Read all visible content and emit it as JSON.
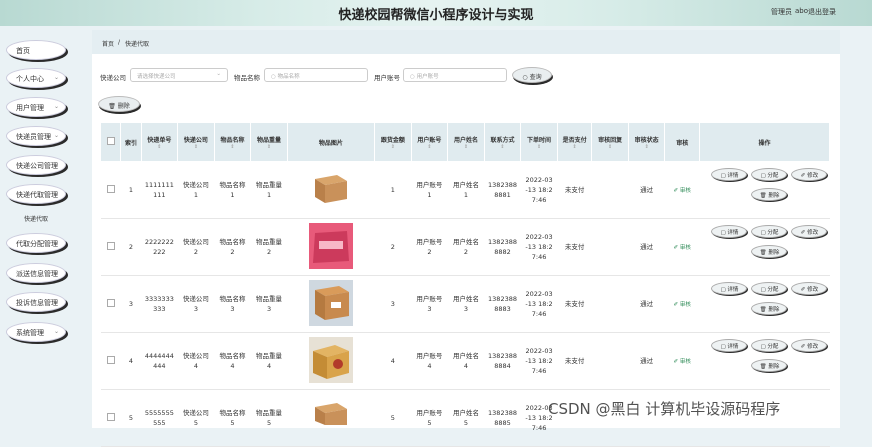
{
  "header": {
    "title": "快递校园帮微信小程序设计与实现",
    "admin_role": "管理员",
    "admin_name": "abo",
    "logout": "退出登录"
  },
  "sidebar": {
    "items": [
      {
        "label": "首页",
        "chev": ""
      },
      {
        "label": "个人中心",
        "chev": "⌄"
      },
      {
        "label": "用户管理",
        "chev": "⌄"
      },
      {
        "label": "快递员管理",
        "chev": "⌄"
      },
      {
        "label": "快递公司管理",
        "chev": "⌄"
      },
      {
        "label": "快递代取管理",
        "chev": "⌄"
      },
      {
        "label": "代取分配管理",
        "chev": "⌄"
      },
      {
        "label": "派送信息管理",
        "chev": "⌄"
      },
      {
        "label": "投诉信息管理",
        "chev": "⌄"
      },
      {
        "label": "系统管理",
        "chev": "⌄"
      }
    ],
    "sub": "快递代取"
  },
  "breadcrumb": {
    "home": "首页",
    "sep": "/",
    "current": "快递代取"
  },
  "filters": {
    "company_label": "快递公司",
    "company_ph": "请选择快递公司",
    "goods_label": "物品名称",
    "goods_ph": "物品名称",
    "user_label": "用户账号",
    "user_ph": "用户账号",
    "search": "查询"
  },
  "actions": {
    "delete": "删除"
  },
  "table": {
    "headers": {
      "index": "索引",
      "num": "快递单号",
      "company": "快递公司",
      "name": "物品名称",
      "weight": "物品重量",
      "image": "物品图片",
      "fee": "跟货金额",
      "account": "用户账号",
      "uname": "用户姓名",
      "contact": "联系方式",
      "time": "下单时间",
      "paid": "是否支付",
      "reply": "审核回复",
      "status": "审核状态",
      "audit": "审核",
      "ops": "操作"
    },
    "sort_arrows": "⇕",
    "rows": [
      {
        "index": "1",
        "num": "1111111\n111",
        "company": "快递公司\n1",
        "name": "物品名称\n1",
        "weight": "物品重量\n1",
        "fee": "1",
        "account": "用户账号\n1",
        "uname": "用户姓名\n1",
        "contact": "1382388\n8881",
        "time": "2022-03\n-13 18:2\n7:46",
        "paid": "未支付",
        "reply": "",
        "status": "通过",
        "audit": "✐ 审核"
      },
      {
        "index": "2",
        "num": "2222222\n222",
        "company": "快递公司\n2",
        "name": "物品名称\n2",
        "weight": "物品重量\n2",
        "fee": "2",
        "account": "用户账号\n2",
        "uname": "用户姓名\n2",
        "contact": "1382388\n8882",
        "time": "2022-03\n-13 18:2\n7:46",
        "paid": "未支付",
        "reply": "",
        "status": "通过",
        "audit": "✐ 审核"
      },
      {
        "index": "3",
        "num": "3333333\n333",
        "company": "快递公司\n3",
        "name": "物品名称\n3",
        "weight": "物品重量\n3",
        "fee": "3",
        "account": "用户账号\n3",
        "uname": "用户姓名\n3",
        "contact": "1382388\n8883",
        "time": "2022-03\n-13 18:2\n7:46",
        "paid": "未支付",
        "reply": "",
        "status": "通过",
        "audit": "✐ 审核"
      },
      {
        "index": "4",
        "num": "4444444\n444",
        "company": "快递公司\n4",
        "name": "物品名称\n4",
        "weight": "物品重量\n4",
        "fee": "4",
        "account": "用户账号\n4",
        "uname": "用户姓名\n4",
        "contact": "1382388\n8884",
        "time": "2022-03\n-13 18:2\n7:46",
        "paid": "未支付",
        "reply": "",
        "status": "通过",
        "audit": "✐ 审核"
      },
      {
        "index": "5",
        "num": "5555555\n555",
        "company": "快递公司\n5",
        "name": "物品名称\n5",
        "weight": "物品重量\n5",
        "fee": "5",
        "account": "用户账号\n5",
        "uname": "用户姓名\n5",
        "contact": "1382388\n8885",
        "time": "2022-03\n-13 18:2\n7:46",
        "paid": "",
        "reply": "",
        "status": "",
        "audit": ""
      }
    ],
    "op_labels": {
      "detail": "详情",
      "assign": "分配",
      "edit": "修改",
      "delete": "删除"
    }
  },
  "watermark": "CSDN @黑白   计算机毕设源码程序"
}
